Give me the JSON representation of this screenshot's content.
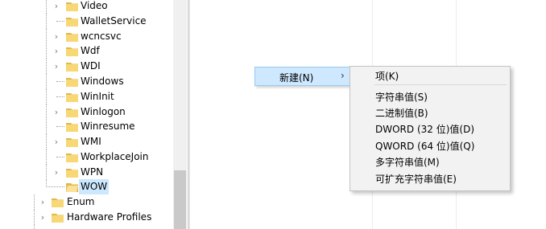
{
  "tree": {
    "items": [
      {
        "label": "Video",
        "expander": "chevron-right"
      },
      {
        "label": "WalletService",
        "expander": "none"
      },
      {
        "label": "wcncsvc",
        "expander": "chevron-right"
      },
      {
        "label": "Wdf",
        "expander": "chevron-right"
      },
      {
        "label": "WDI",
        "expander": "chevron-right"
      },
      {
        "label": "Windows",
        "expander": "none"
      },
      {
        "label": "WinInit",
        "expander": "none"
      },
      {
        "label": "Winlogon",
        "expander": "chevron-right"
      },
      {
        "label": "Winresume",
        "expander": "none"
      },
      {
        "label": "WMI",
        "expander": "chevron-right"
      },
      {
        "label": "WorkplaceJoin",
        "expander": "none"
      },
      {
        "label": "WPN",
        "expander": "chevron-right"
      },
      {
        "label": "WOW",
        "expander": "none",
        "selected": true
      },
      {
        "label": "Enum",
        "expander": "chevron-right"
      },
      {
        "label": "Hardware Profiles",
        "expander": "chevron-right"
      }
    ]
  },
  "context_menu": {
    "new_label": "新建(N)",
    "new_arrow": "›"
  },
  "submenu": {
    "items": [
      "项(K)",
      "字符串值(S)",
      "二进制值(B)",
      "DWORD (32 位)值(D)",
      "QWORD (64 位)值(Q)",
      "多字符串值(M)",
      "可扩充字符串值(E)"
    ]
  },
  "colors": {
    "selection": "#cce8ff",
    "folder_fill": "#f8d775",
    "folder_dark": "#e0b84c",
    "menu_bg": "#f2f2f2",
    "hover_bg": "#cde8ff"
  }
}
